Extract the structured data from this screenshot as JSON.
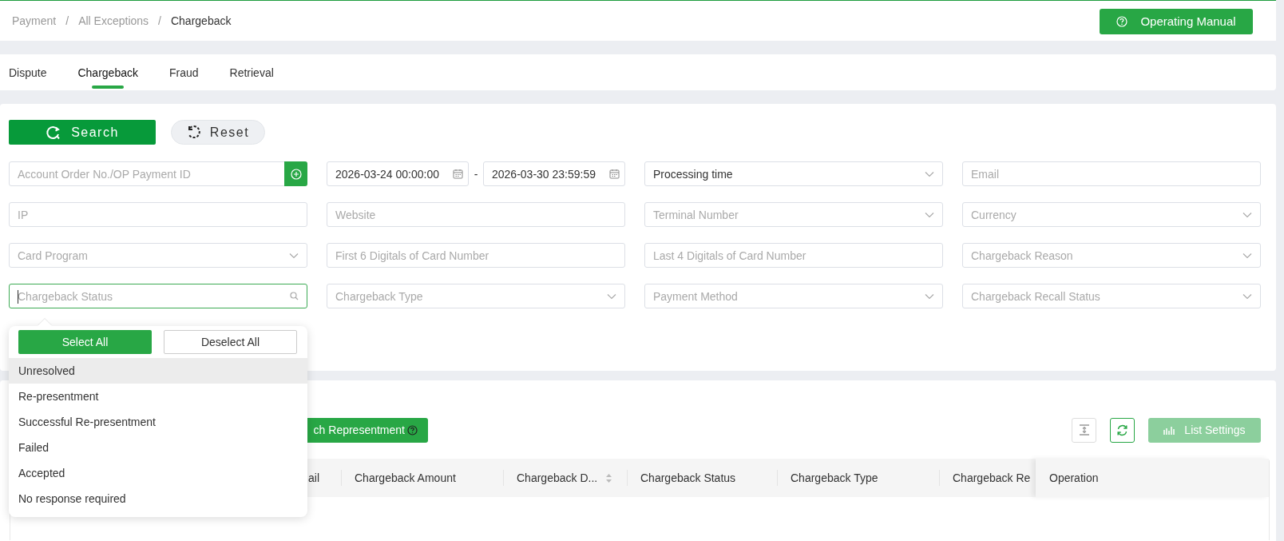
{
  "breadcrumb": [
    {
      "label": "Payment",
      "current": false
    },
    {
      "label": "All Exceptions",
      "current": false
    },
    {
      "label": "Chargeback",
      "current": true
    }
  ],
  "breadcrumb_separator": "/",
  "manual_button": {
    "label": "Operating Manual"
  },
  "tabs": [
    {
      "label": "Dispute",
      "selected": false
    },
    {
      "label": "Chargeback",
      "selected": true
    },
    {
      "label": "Fraud",
      "selected": false
    },
    {
      "label": "Retrieval",
      "selected": false
    }
  ],
  "search_button": {
    "label": "Search"
  },
  "reset_button": {
    "label": "Reset"
  },
  "filters": [
    {
      "kind": "add_input",
      "placeholder": "Account Order No./OP Payment ID"
    },
    {
      "kind": "date_range",
      "start": "2026-03-24 00:00:00",
      "separator": "-",
      "end": "2026-03-30 23:59:59"
    },
    {
      "kind": "select",
      "value": "Processing time"
    },
    {
      "kind": "input",
      "placeholder": "Email"
    },
    {
      "kind": "input",
      "placeholder": "IP"
    },
    {
      "kind": "input",
      "placeholder": "Website"
    },
    {
      "kind": "select",
      "placeholder": "Terminal Number"
    },
    {
      "kind": "select",
      "placeholder": "Currency"
    },
    {
      "kind": "select",
      "placeholder": "Card Program"
    },
    {
      "kind": "input",
      "placeholder": "First 6 Digitals of Card Number"
    },
    {
      "kind": "input",
      "placeholder": "Last 4 Digitals of Card Number"
    },
    {
      "kind": "select",
      "placeholder": "Chargeback Reason"
    },
    {
      "kind": "search_select",
      "placeholder": "Chargeback Status",
      "focused": true
    },
    {
      "kind": "select",
      "placeholder": "Chargeback Type"
    },
    {
      "kind": "select",
      "placeholder": "Payment Method"
    },
    {
      "kind": "select",
      "placeholder": "Chargeback Recall Status"
    }
  ],
  "dropdown": {
    "select_all": "Select All",
    "deselect_all": "Deselect All",
    "options": [
      {
        "label": "Unresolved",
        "highlighted": true
      },
      {
        "label": "Re-presentment",
        "highlighted": false
      },
      {
        "label": "Successful Re-presentment",
        "highlighted": false
      },
      {
        "label": "Failed",
        "highlighted": false
      },
      {
        "label": "Accepted",
        "highlighted": false
      },
      {
        "label": "No response required",
        "highlighted": false
      }
    ]
  },
  "batch_button": {
    "label": "ch Representment"
  },
  "list_settings_button": {
    "label": "List Settings",
    "disabled": true
  },
  "table": {
    "columns": [
      {
        "label": "ail",
        "sortable": false
      },
      {
        "label": "Chargeback Amount",
        "sortable": false
      },
      {
        "label": "Chargeback D...",
        "sortable": true
      },
      {
        "label": "Chargeback Status",
        "sortable": false
      },
      {
        "label": "Chargeback Type",
        "sortable": false
      },
      {
        "label": "Chargeback Re",
        "sortable": false
      },
      {
        "label": "Operation",
        "sortable": false,
        "fixed": true
      }
    ]
  }
}
